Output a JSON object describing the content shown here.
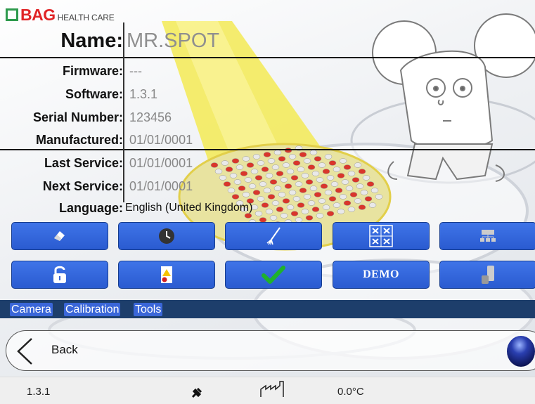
{
  "logo": {
    "brand": "BAG",
    "subtitle": "HEALTH CARE"
  },
  "device": {
    "name_label": "Name:",
    "name_value": "MR.SPOT",
    "rows": [
      {
        "label": "Firmware:",
        "value": "---"
      },
      {
        "label": "Software:",
        "value": "1.3.1"
      },
      {
        "label": "Serial Number:",
        "value": "123456"
      },
      {
        "label": "Manufactured:",
        "value": "01/01/0001"
      },
      {
        "label": "Last Service:",
        "value": "01/01/0001"
      },
      {
        "label": "Next Service:",
        "value": "01/01/0001"
      },
      {
        "label": "Language:",
        "value": "English (United Kingdom)"
      }
    ]
  },
  "toolbar_row1": [
    {
      "icon": "eraser-icon"
    },
    {
      "icon": "clock-icon"
    },
    {
      "icon": "brush-icon"
    },
    {
      "icon": "grid-x-icon"
    },
    {
      "icon": "network-icon"
    }
  ],
  "toolbar_row2": [
    {
      "icon": "unlock-icon"
    },
    {
      "icon": "warning-document-icon"
    },
    {
      "icon": "checkmark-icon"
    },
    {
      "icon": "demo-text",
      "label": "DEMO"
    },
    {
      "icon": "usb-icon"
    }
  ],
  "tools": [
    "Camera",
    "Calibration",
    "Tools"
  ],
  "back": {
    "label": "Back"
  },
  "status": {
    "version": "1.3.1",
    "temperature": "0.0°C"
  },
  "colors": {
    "button_blue": "#3a66d8",
    "tools_bar": "#1d3e6b",
    "brand_red": "#e02426",
    "brand_green": "#2e9a4d"
  }
}
